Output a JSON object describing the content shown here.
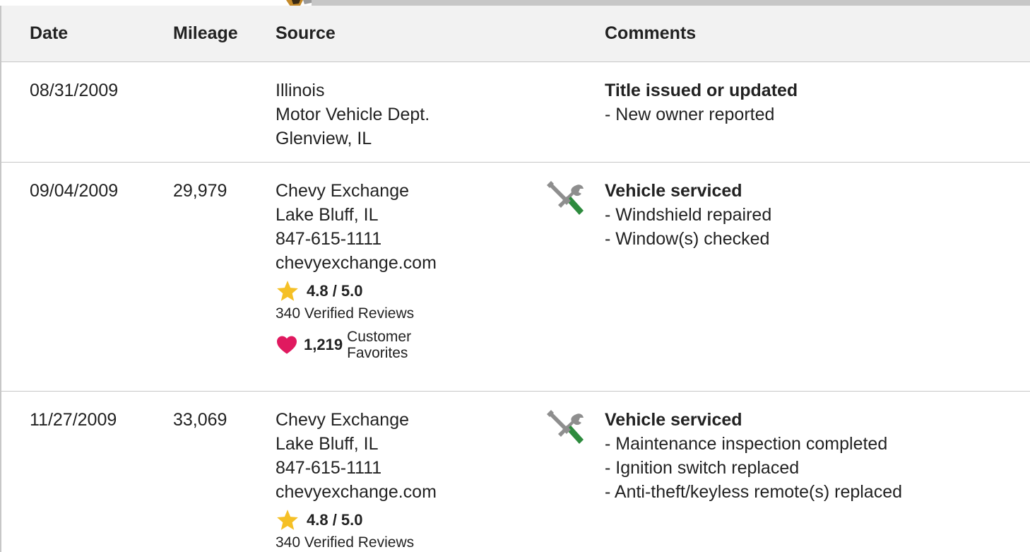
{
  "table": {
    "headers": {
      "date": "Date",
      "mileage": "Mileage",
      "source": "Source",
      "comments": "Comments"
    },
    "rows": [
      {
        "date": "08/31/2009",
        "mileage": "",
        "source": [
          "Illinois",
          "Motor Vehicle Dept.",
          "Glenview, IL"
        ],
        "icon": "",
        "comment_title": "Title issued or updated",
        "comment_items": [
          "New owner reported"
        ]
      },
      {
        "date": "09/04/2009",
        "mileage": "29,979",
        "source": [
          "Chevy Exchange",
          "Lake Bluff, IL",
          "847-615-1111",
          "chevyexchange.com"
        ],
        "rating": "4.8 / 5.0",
        "reviews": "340 Verified Reviews",
        "favorites_count": "1,219",
        "favorites_label": "Customer Favorites",
        "icon": "wrench-screwdriver-icon",
        "comment_title": "Vehicle serviced",
        "comment_items": [
          "Windshield repaired",
          "Window(s) checked"
        ]
      },
      {
        "date": "11/27/2009",
        "mileage": "33,069",
        "source": [
          "Chevy Exchange",
          "Lake Bluff, IL",
          "847-615-1111",
          "chevyexchange.com"
        ],
        "rating": "4.8 / 5.0",
        "reviews": "340 Verified Reviews",
        "icon": "wrench-screwdriver-icon",
        "comment_title": "Vehicle serviced",
        "comment_items": [
          "Maintenance inspection completed",
          "Ignition switch replaced",
          "Anti-theft/keyless remote(s) replaced"
        ]
      }
    ]
  },
  "colors": {
    "header_bg": "#f2f2f2",
    "border": "#c7c7c7",
    "star": "#f5c026",
    "heart": "#e0195f",
    "tool_grey": "#8e8e8e",
    "tool_green": "#2e8b3e"
  }
}
